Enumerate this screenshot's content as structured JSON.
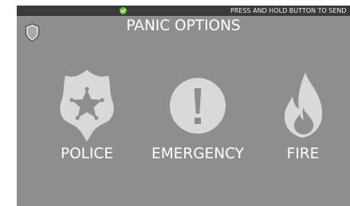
{
  "status_bar": {
    "message": "PRESS  AND HOLD BUTTON TO SEND",
    "indicator_color": "#6cc04a",
    "indicator_icon": "check-icon"
  },
  "header": {
    "title": "PANIC OPTIONS",
    "menu_icon": "shield-icon"
  },
  "panic_buttons": [
    {
      "label": "POLICE",
      "icon": "police-badge-icon"
    },
    {
      "label": "EMERGENCY",
      "icon": "exclamation-icon"
    },
    {
      "label": "FIRE",
      "icon": "flame-icon"
    }
  ],
  "colors": {
    "screen_background": "#8e8e8e",
    "status_bar": "#3a3a3a",
    "icon_fill": "#d9d9d9",
    "text": "#ffffff"
  }
}
